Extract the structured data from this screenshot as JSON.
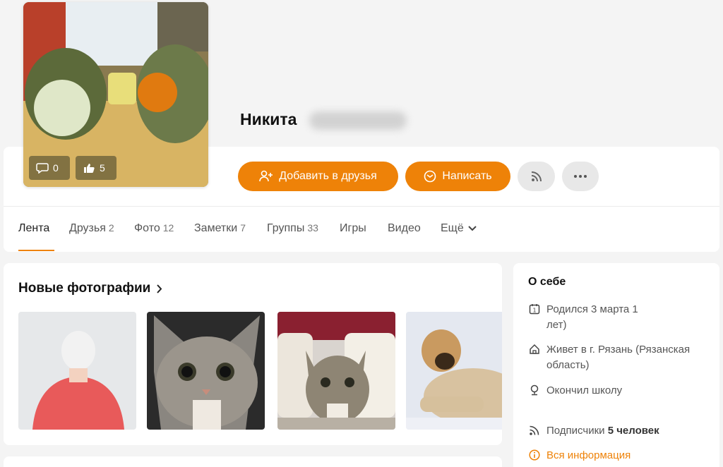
{
  "profile": {
    "name": "Никита",
    "avatar_comments": "0",
    "avatar_likes": "5"
  },
  "actions": {
    "add_friend": "Добавить в друзья",
    "message": "Написать"
  },
  "tabs": [
    {
      "label": "Лента",
      "count": ""
    },
    {
      "label": "Друзья",
      "count": "2"
    },
    {
      "label": "Фото",
      "count": "12"
    },
    {
      "label": "Заметки",
      "count": "7"
    },
    {
      "label": "Группы",
      "count": "33"
    },
    {
      "label": "Игры",
      "count": ""
    },
    {
      "label": "Видео",
      "count": ""
    },
    {
      "label": "Ещё",
      "count": ""
    }
  ],
  "photos": {
    "title": "Новые фотографии"
  },
  "about": {
    "title": "О себе",
    "birth": "Родился 3 марта 1",
    "birth_tail": "лет)",
    "lives": "Живет в г. Рязань (Рязанская",
    "lives_tail": "область)",
    "school": "Окончил школу",
    "subscribers_label": "Подписчики",
    "subscribers_value": "5 человек",
    "all_info": "Вся информация"
  },
  "colors": {
    "accent": "#ee8208",
    "background": "#f4f4f4"
  }
}
